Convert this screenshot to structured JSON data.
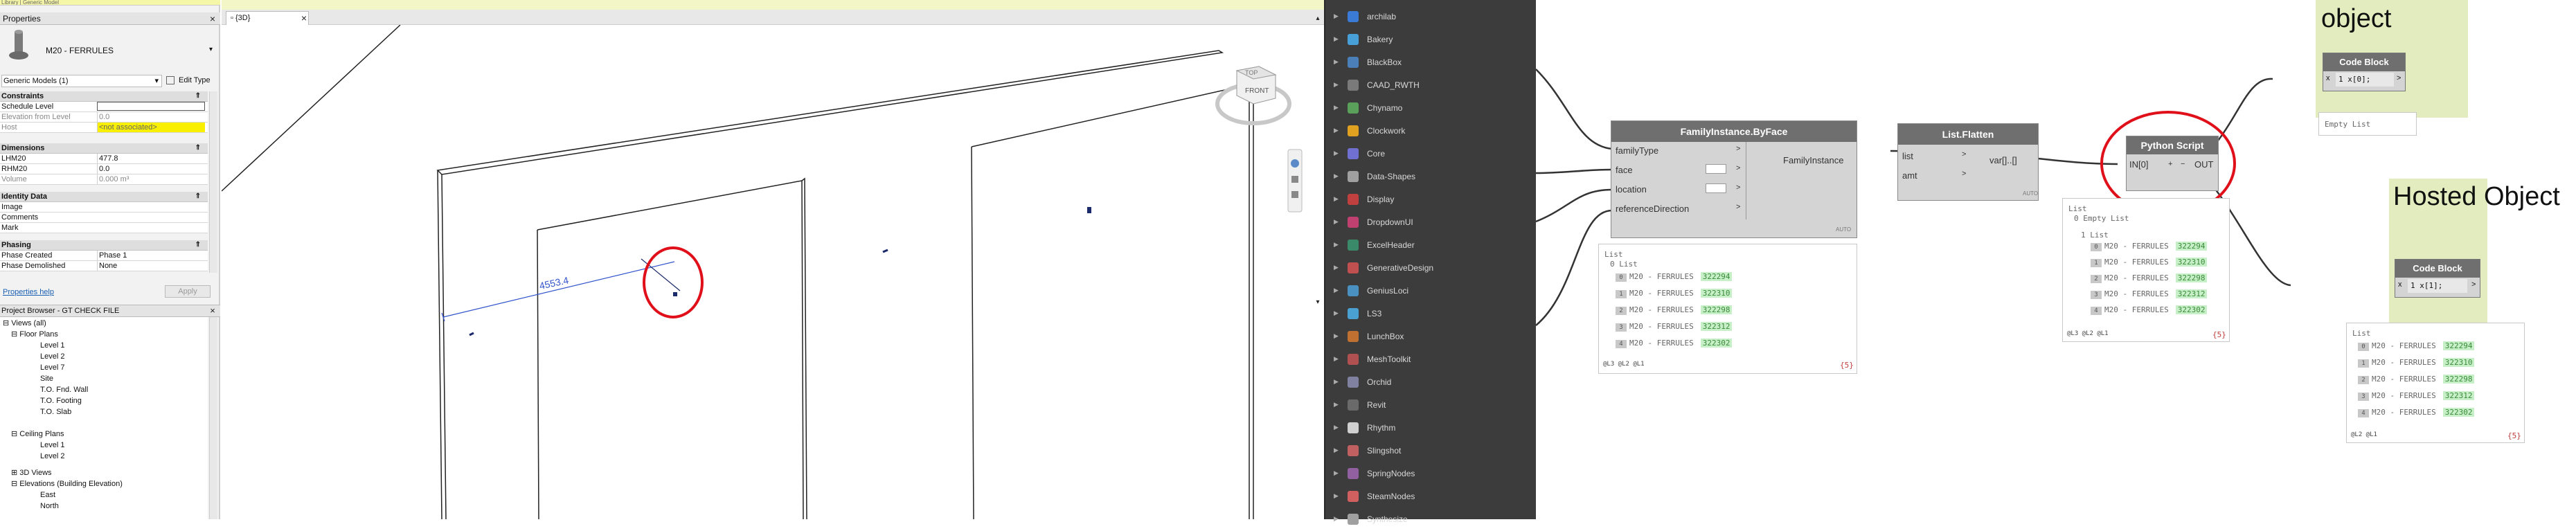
{
  "app": {
    "window_title": "Library | Generic Model"
  },
  "properties": {
    "title": "Properties",
    "family_name": "M20 - FERRULES",
    "type_selector": "Generic Models (1)",
    "edit_type": "Edit Type",
    "groups": {
      "constraints": "Constraints",
      "dimensions": "Dimensions",
      "identity": "Identity Data",
      "phasing": "Phasing"
    },
    "rows": {
      "schedule_level": {
        "k": "Schedule Level",
        "v": ""
      },
      "elevation_from_level": {
        "k": "Elevation from Level",
        "v": "0.0"
      },
      "host": {
        "k": "Host",
        "v": "<not associated>"
      },
      "lhm20": {
        "k": "LHM20",
        "v": "477.8"
      },
      "rhm20": {
        "k": "RHM20",
        "v": "0.0"
      },
      "volume": {
        "k": "Volume",
        "v": "0.000 m³"
      },
      "image": {
        "k": "Image",
        "v": ""
      },
      "comments": {
        "k": "Comments",
        "v": ""
      },
      "mark": {
        "k": "Mark",
        "v": ""
      },
      "phase_created": {
        "k": "Phase Created",
        "v": "Phase 1"
      },
      "phase_demolished": {
        "k": "Phase Demolished",
        "v": "None"
      }
    },
    "help_link": "Properties help",
    "apply": "Apply"
  },
  "browser": {
    "title": "Project Browser - GT CHECK FILE",
    "items": [
      "Views (all)",
      "Floor Plans",
      "Level 1",
      "Level 2",
      "Level 7",
      "Site",
      "T.O. Fnd. Wall",
      "T.O. Footing",
      "T.O. Slab",
      "Ceiling Plans",
      "Level 1",
      "Level 2",
      "3D Views",
      "Elevations (Building Elevation)",
      "East",
      "North"
    ]
  },
  "view": {
    "tab_label": "{3D}",
    "dimension": "4553.4",
    "viewcube_face": "FRONT",
    "viewcube_top": "TOP"
  },
  "library": {
    "items": [
      "archilab",
      "Bakery",
      "BlackBox",
      "CAAD_RWTH",
      "Chynamo",
      "Clockwork",
      "Core",
      "Data-Shapes",
      "Display",
      "DropdownUI",
      "ExcelHeader",
      "GenerativeDesign",
      "GeniusLoci",
      "LS3",
      "LunchBox",
      "MeshToolkit",
      "Orchid",
      "Revit",
      "Rhythm",
      "Slingshot",
      "SpringNodes",
      "SteamNodes",
      "Synthesize"
    ],
    "colors": [
      "#3a7bd5",
      "#48a0d8",
      "#4a7fb8",
      "#7a7a7a",
      "#5aa05a",
      "#e0a020",
      "#7070d0",
      "#a0a0a0",
      "#c04040",
      "#c04070",
      "#3a8a6a",
      "#c05050",
      "#4a90c0",
      "#4aa0d0",
      "#c07030",
      "#b05050",
      "#8080a0",
      "#6a6a6a",
      "#d0d0d0",
      "#c06060",
      "#9060a0",
      "#d06060",
      "#a0a0a0"
    ]
  },
  "nodes": {
    "fibf": {
      "title": "FamilyInstance.ByFace",
      "inputs": [
        "familyType",
        "face",
        "location",
        "referenceDirection"
      ],
      "output": "FamilyInstance",
      "lacing": "AUTO"
    },
    "flatten": {
      "title": "List.Flatten",
      "inputs": [
        "list",
        "amt"
      ],
      "output": "var[]..[]",
      "lacing": "AUTO"
    },
    "python": {
      "title": "Python Script",
      "input": "IN[0]",
      "output": "OUT"
    },
    "cb1": {
      "title": "Code Block",
      "code": "1 x[0];",
      "port_in": "x",
      "port_out": ">"
    },
    "cb2": {
      "title": "Code Block",
      "code": "1 x[1];",
      "port_in": "x",
      "port_out": ">"
    }
  },
  "previews": {
    "fibf": {
      "header": "List",
      "sub": "0 List",
      "rows": [
        {
          "i": "0",
          "t": "M20 - FERRULES",
          "id": "322294"
        },
        {
          "i": "1",
          "t": "M20 - FERRULES",
          "id": "322310"
        },
        {
          "i": "2",
          "t": "M20 - FERRULES",
          "id": "322298"
        },
        {
          "i": "3",
          "t": "M20 - FERRULES",
          "id": "322312"
        },
        {
          "i": "4",
          "t": "M20 - FERRULES",
          "id": "322302"
        }
      ],
      "footer": "@L3 @L2 @L1",
      "count": "{5}"
    },
    "python": {
      "header": "List",
      "empty": "0 Empty List",
      "sub": "1 List",
      "rows": [
        {
          "i": "0",
          "t": "M20 - FERRULES",
          "id": "322294"
        },
        {
          "i": "1",
          "t": "M20 - FERRULES",
          "id": "322310"
        },
        {
          "i": "2",
          "t": "M20 - FERRULES",
          "id": "322298"
        },
        {
          "i": "3",
          "t": "M20 - FERRULES",
          "id": "322312"
        },
        {
          "i": "4",
          "t": "M20 - FERRULES",
          "id": "322302"
        }
      ],
      "footer": "@L3 @L2 @L1",
      "count": "{5}"
    },
    "cb1": {
      "text": "Empty List"
    },
    "cb2": {
      "header": "List",
      "rows": [
        {
          "i": "0",
          "t": "M20 - FERRULES",
          "id": "322294"
        },
        {
          "i": "1",
          "t": "M20 - FERRULES",
          "id": "322310"
        },
        {
          "i": "2",
          "t": "M20 - FERRULES",
          "id": "322298"
        },
        {
          "i": "3",
          "t": "M20 - FERRULES",
          "id": "322312"
        },
        {
          "i": "4",
          "t": "M20 - FERRULES",
          "id": "322302"
        }
      ],
      "footer": "@L2 @L1",
      "count": "{5}"
    }
  },
  "groups": {
    "object": "object",
    "hosted": "Hosted Object"
  },
  "colors": {
    "group_bg": "#e2ecbe",
    "annotation_red": "#e0101a",
    "node_header": "#6f6f6f",
    "library_bg": "#3c3c3c",
    "id_green": "#c8f0c8"
  }
}
